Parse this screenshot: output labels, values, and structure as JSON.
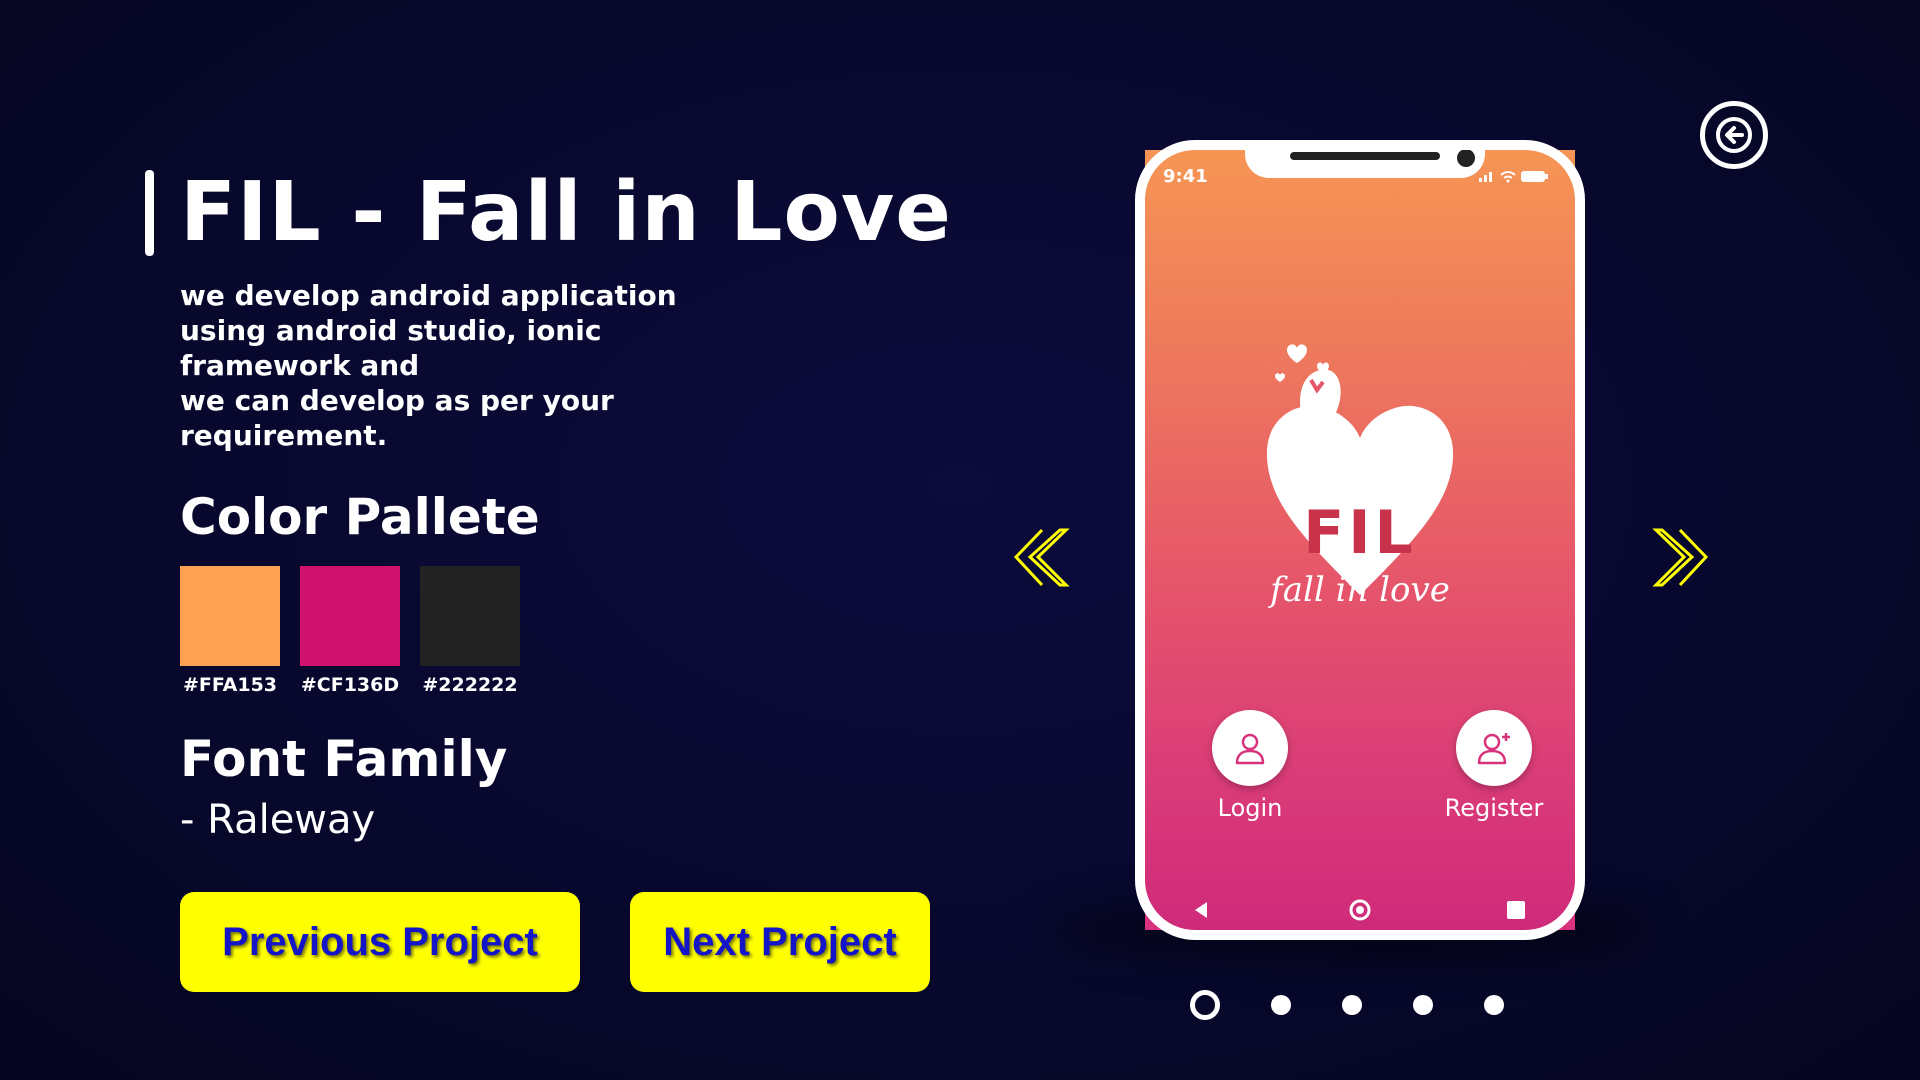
{
  "project": {
    "title": "FIL - Fall in Love",
    "description": "we develop android application\nusing android studio, ionic\nframework and\nwe can develop as per your\nrequirement."
  },
  "palette": {
    "heading": "Color Pallete",
    "colors": [
      {
        "hex": "#FFA153",
        "label": "#FFA153"
      },
      {
        "hex": "#CF136D",
        "label": "#CF136D"
      },
      {
        "hex": "#222222",
        "label": "#222222"
      }
    ]
  },
  "font": {
    "heading": "Font Family",
    "name": "- Raleway"
  },
  "buttons": {
    "previous": "Previous Project",
    "next": "Next Project"
  },
  "phone": {
    "time": "9:41",
    "logo_text": "FIL",
    "logo_subtitle": "fall in love",
    "login_label": "Login",
    "register_label": "Register"
  },
  "carousel": {
    "total_slides": 5,
    "active_slide": 1
  },
  "colors": {
    "accent_yellow": "#FFFF00",
    "button_text": "#1414C8",
    "background": "#08082E"
  },
  "icons": [
    "back-arrow-icon",
    "chevron-left-icon",
    "chevron-right-icon",
    "user-icon",
    "user-plus-icon"
  ]
}
